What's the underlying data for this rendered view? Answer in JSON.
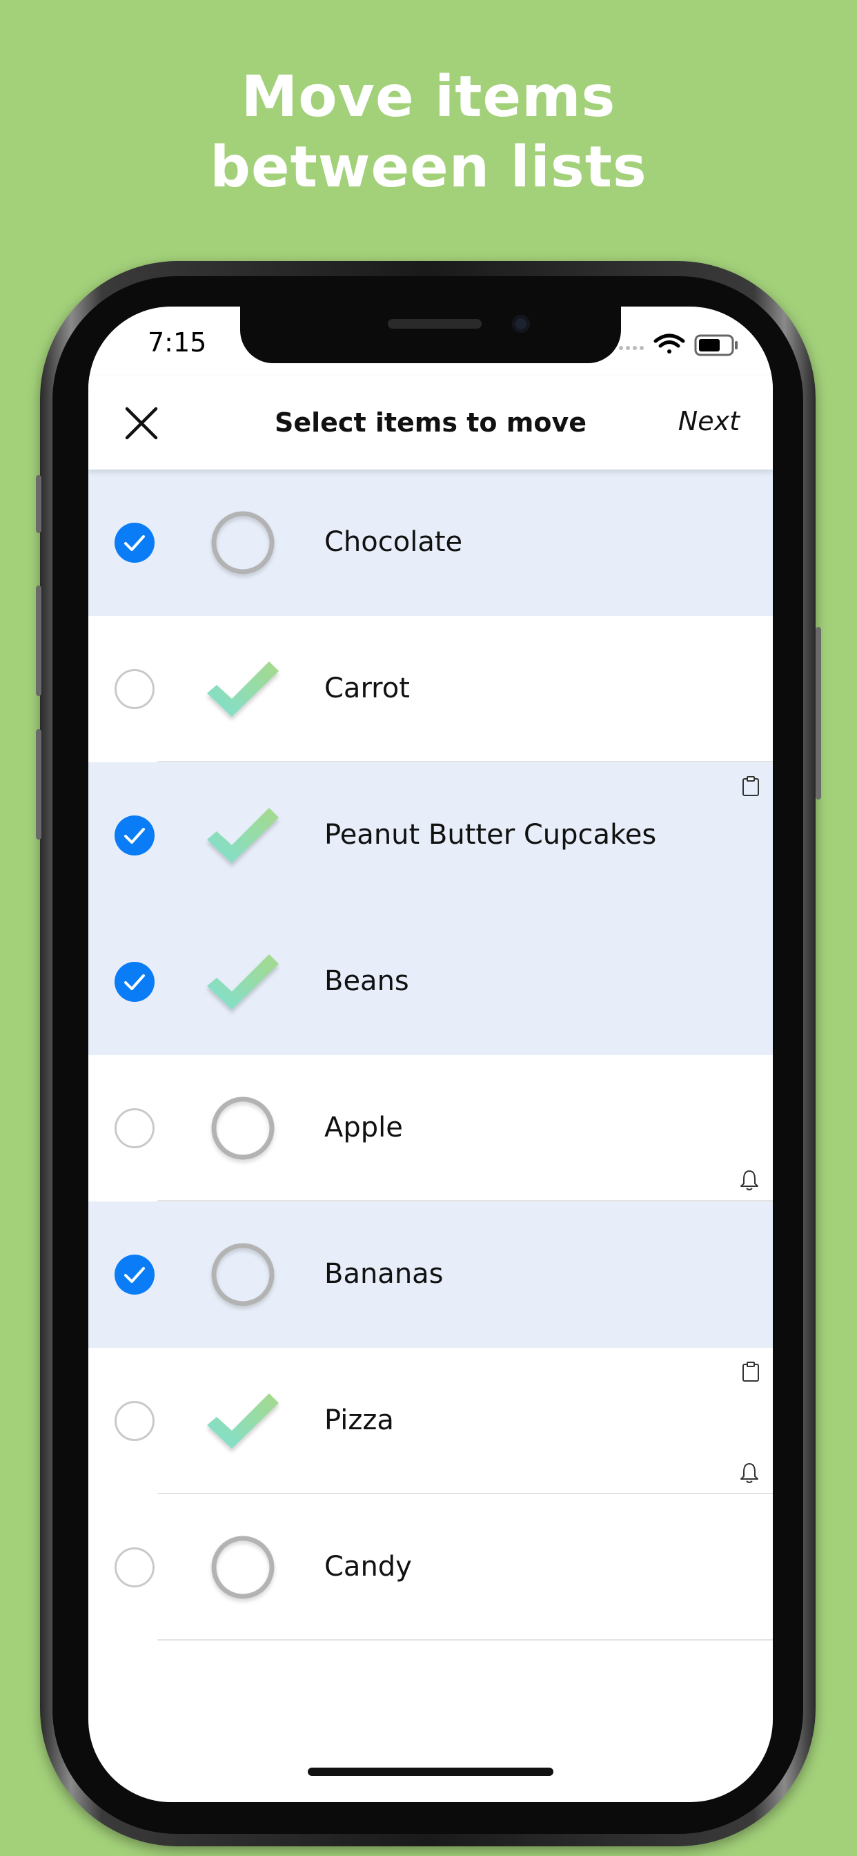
{
  "headline": {
    "line1": "Move items",
    "line2": "between lists"
  },
  "status_bar": {
    "time": "7:15"
  },
  "navbar": {
    "title": "Select items to move",
    "next_label": "Next"
  },
  "items": [
    {
      "name": "Chocolate",
      "selected": true,
      "status": "circle",
      "note": false,
      "reminder": false
    },
    {
      "name": "Carrot",
      "selected": false,
      "status": "check",
      "note": false,
      "reminder": false
    },
    {
      "name": "Peanut Butter Cupcakes",
      "selected": true,
      "status": "check",
      "note": true,
      "reminder": false
    },
    {
      "name": "Beans",
      "selected": true,
      "status": "check",
      "note": false,
      "reminder": false
    },
    {
      "name": "Apple",
      "selected": false,
      "status": "circle",
      "note": false,
      "reminder": true
    },
    {
      "name": "Bananas",
      "selected": true,
      "status": "circle",
      "note": false,
      "reminder": false
    },
    {
      "name": "Pizza",
      "selected": false,
      "status": "check",
      "note": true,
      "reminder": true
    },
    {
      "name": "Candy",
      "selected": false,
      "status": "circle",
      "note": false,
      "reminder": false
    }
  ],
  "colors": {
    "background": "#a3d17a",
    "accent": "#0a7cf6",
    "selected_row": "#e7eef9",
    "check_gradient_start": "#7edfd3",
    "check_gradient_end": "#a6d98a"
  },
  "icons": {
    "close": "close-icon",
    "select_on": "checkmark-circle-icon",
    "status_done": "gradient-checkmark-icon",
    "status_open": "empty-circle-icon",
    "note": "clipboard-icon",
    "reminder": "bell-icon"
  }
}
